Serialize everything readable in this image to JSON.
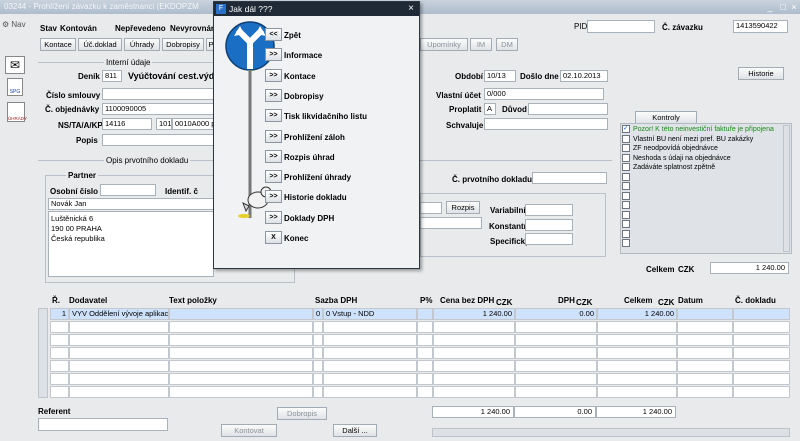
{
  "window": {
    "title": "03244 - Prohlížení závazku k zaměstnanci (EKDOPZM"
  },
  "sidebar": {
    "nav_label": "Nav",
    "icons": [
      {
        "name": "transfer-icon"
      },
      {
        "name": "spg-icon",
        "label": "SPG"
      },
      {
        "name": "uhrady-icon",
        "label": "ÚHRADY"
      }
    ]
  },
  "header": {
    "stav_label": "Stav",
    "stav_value": "Kontován",
    "neprevedeno": "Nepřevedeno",
    "nevyrovnano": "Nevyrovnán",
    "pid_label": "PID",
    "pid_value": "",
    "cislo_zavazku_label": "Č. závazku",
    "cislo_zavazku_value": "1413590422"
  },
  "tabs": [
    "Kontace",
    "Úč.doklad",
    "Úhrady",
    "Dobropisy",
    "P",
    "Upomínky",
    "IM",
    "DM"
  ],
  "interni": {
    "section_label": "Interní údaje",
    "denik_label": "Deník",
    "denik_value": "811",
    "denik_text": "Vyúčtování cest.výdaj",
    "cislo_smlouvy_label": "Číslo smlouvy",
    "cislo_smlouvy_value": "",
    "cislo_objednavky_label": "Č. objednávky",
    "cislo_objednavky_value": "1100090005",
    "ns_label": "NS/TA/A/KP",
    "ns_value": "14116",
    "ta_value": "101",
    "a_value": "0010A000 p",
    "popis_label": "Popis",
    "popis_value": ""
  },
  "right_fields": {
    "obdobi_label": "Období",
    "obdobi_value": "10/13",
    "doslo_dne_label": "Došlo dne",
    "doslo_dne_value": "02.10.2013",
    "vlastni_ucet_label": "Vlastní účet",
    "vlastni_ucet_value": "0/000",
    "proplatit_label": "Proplatit",
    "proplatit_value": "A",
    "duvod_label": "Důvod",
    "duvod_value": "",
    "schvaluje_label": "Schvaluje",
    "schvaluje_value": "",
    "historie_btn": "Historie"
  },
  "opis": {
    "section_label": "Opis prvotního dokladu",
    "partner_label": "Partner",
    "osobni_cislo_label": "Osobní číslo",
    "osobni_cislo_value": "",
    "identif_label": "Identif. č",
    "name_value": "Novák Jan",
    "address_lines": [
      "Luštěnická 6",
      "190 00   PRAHA",
      "Česká republika"
    ],
    "c_prvotniho_label": "Č. prvotního dokladu",
    "c_prvotniho_value": "",
    "rozpis_btn": "Rozpis",
    "variabilni_label": "Variabilní s.",
    "konstantni_label": "Konstantní s.",
    "specificky_label": "Specifický s."
  },
  "kontroly": {
    "title": "Kontroly",
    "items": [
      {
        "text": "Pozor! K této neinvestiční faktuře je připojena",
        "checked": true,
        "color": "#1a8a1a"
      },
      {
        "text": "Vlastní BU není mezi pref. BU zakázky",
        "checked": false,
        "color": "#000000"
      },
      {
        "text": "ZF neodpovídá objednávce",
        "checked": false,
        "color": "#000000"
      },
      {
        "text": "Neshoda s údaji na objednávce",
        "checked": false,
        "color": "#000000"
      },
      {
        "text": "Zadáváte splatnost zpětně",
        "checked": false,
        "color": "#000000"
      }
    ],
    "celkem_label": "Celkem",
    "celkem_currency": "CZK",
    "celkem_value": "1 240.00"
  },
  "table": {
    "headers": {
      "r": "Ř.",
      "dodavatel": "Dodavatel",
      "text": "Text položky",
      "sazba": "Sazba DPH",
      "p": "P%",
      "cena": "Cena bez DPH",
      "czk1": "CZK",
      "dph": "DPH",
      "czk2": "CZK",
      "celkem": "Celkem",
      "czk3": "CZK",
      "datum": "Datum",
      "doklad": "Č. dokladu"
    },
    "rows": [
      {
        "r": "1",
        "dodavatel": "VYV Oddělení vývoje aplikac",
        "text": "",
        "sazba_code": "0",
        "sazba": "0 Vstup - NDD",
        "p": "",
        "cena": "1 240.00",
        "dph": "0.00",
        "celkem": "1 240.00",
        "datum": "",
        "doklad": ""
      }
    ],
    "totals": {
      "cena": "1 240.00",
      "dph": "0.00",
      "celkem": "1 240.00"
    }
  },
  "footer": {
    "referent_label": "Referent",
    "referent_value": "",
    "dobropis_btn": "Dobropis",
    "kontovat_btn": "Kontovat",
    "dalsi_btn": "Další ..."
  },
  "dialog": {
    "title": "Jak dál ???",
    "items": [
      {
        "btn": "<<",
        "label": "Zpět"
      },
      {
        "btn": ">>",
        "label": "Informace"
      },
      {
        "btn": ">>",
        "label": "Kontace"
      },
      {
        "btn": ">>",
        "label": "Dobropisy"
      },
      {
        "btn": ">>",
        "label": "Tisk likvidačního listu"
      },
      {
        "btn": ">>",
        "label": "Prohlížení záloh"
      },
      {
        "btn": ">>",
        "label": "Rozpis úhrad"
      },
      {
        "btn": ">>",
        "label": "Prohlížení úhrady"
      },
      {
        "btn": ">>",
        "label": "Historie dokladu"
      },
      {
        "btn": ">>",
        "label": "Doklady DPH"
      },
      {
        "btn": "X",
        "label": "Konec"
      }
    ]
  },
  "colors": {
    "accent": "#1f2a36",
    "sign_blue": "#1a6fc4",
    "selected_row": "#cfe2fb"
  }
}
